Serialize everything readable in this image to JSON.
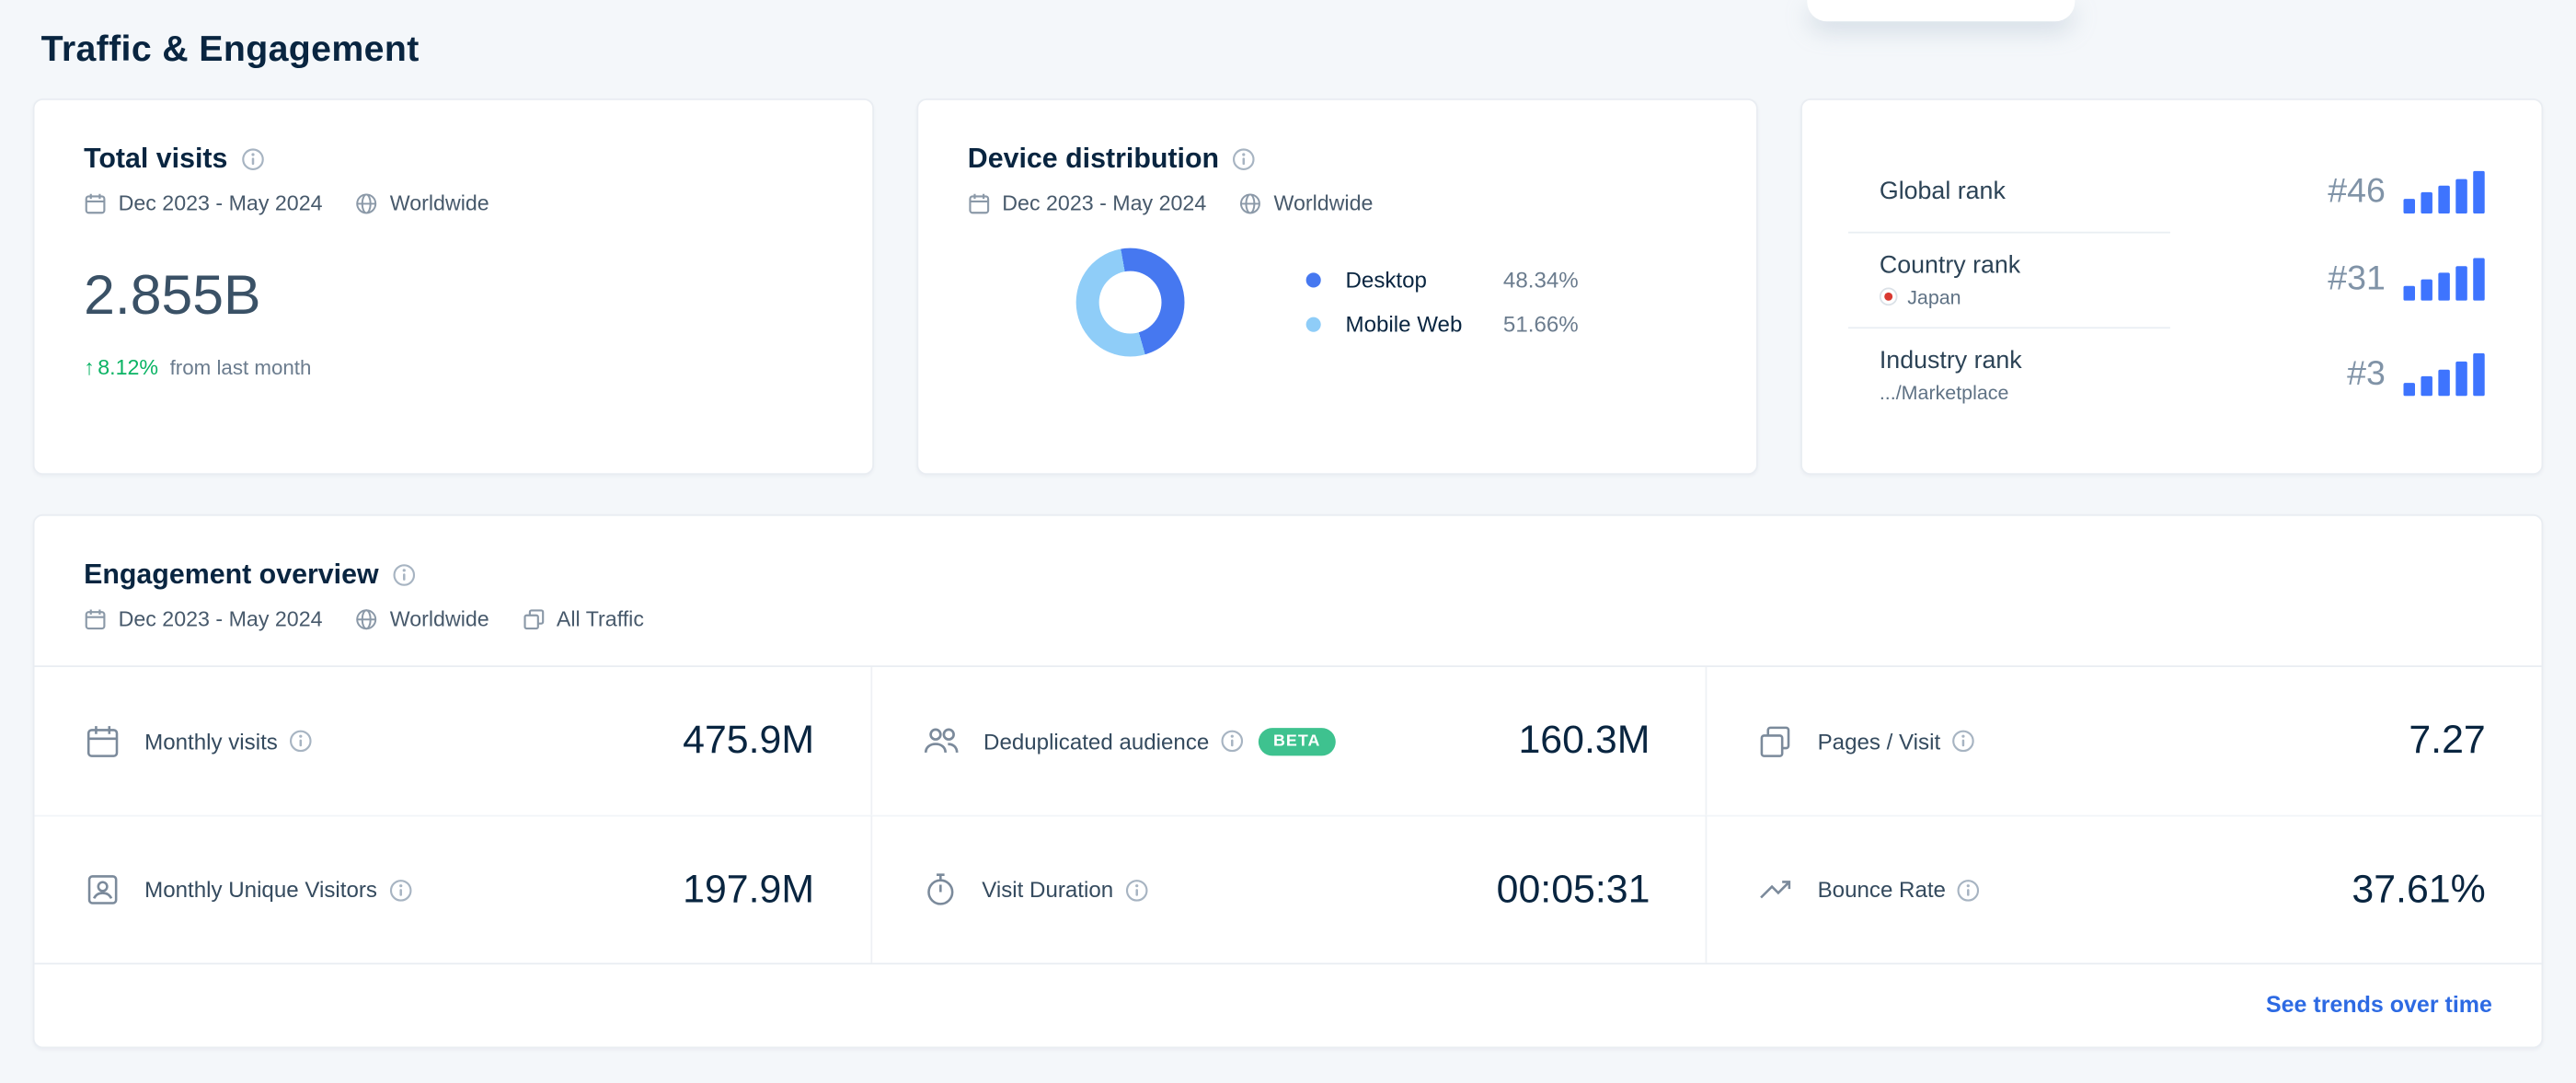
{
  "page": {
    "title": "Traffic & Engagement"
  },
  "total_visits": {
    "title": "Total visits",
    "date_range": "Dec 2023 - May 2024",
    "region": "Worldwide",
    "value": "2.855B",
    "change_arrow": "↑",
    "change": "8.12%",
    "change_label": "from last month"
  },
  "device_distribution": {
    "title": "Device distribution",
    "date_range": "Dec 2023 - May 2024",
    "region": "Worldwide",
    "legend": [
      {
        "label": "Desktop",
        "value": "48.34%",
        "color": "#4678F0"
      },
      {
        "label": "Mobile Web",
        "value": "51.66%",
        "color": "#8FCDF8"
      }
    ]
  },
  "ranks": {
    "global": {
      "label": "Global rank",
      "value": "#46"
    },
    "country": {
      "label": "Country rank",
      "country": "Japan",
      "value": "#31"
    },
    "industry": {
      "label": "Industry rank",
      "category": ".../Marketplace",
      "value": "#3"
    }
  },
  "engagement": {
    "title": "Engagement overview",
    "date_range": "Dec 2023 - May 2024",
    "region": "Worldwide",
    "traffic_type": "All Traffic",
    "metrics": [
      {
        "label": "Monthly visits",
        "value": "475.9M"
      },
      {
        "label": "Deduplicated audience",
        "value": "160.3M",
        "badge": "BETA"
      },
      {
        "label": "Pages / Visit",
        "value": "7.27"
      },
      {
        "label": "Monthly Unique Visitors",
        "value": "197.9M"
      },
      {
        "label": "Visit Duration",
        "value": "00:05:31"
      },
      {
        "label": "Bounce Rate",
        "value": "37.61%"
      }
    ],
    "link": "See trends over time"
  },
  "chart_data": {
    "type": "pie",
    "donut": true,
    "title": "Device distribution",
    "labels": [
      "Desktop",
      "Mobile Web"
    ],
    "values": [
      48.34,
      51.66
    ],
    "colors": [
      "#4678F0",
      "#8FCDF8"
    ],
    "legend_position": "right",
    "start_angle_deg": 350
  },
  "colors": {
    "accent_blue": "#2d6ae3",
    "rank_bars_blue": "#3e74fe",
    "positive_green": "#0ab364",
    "beta_badge": "#3ec28f",
    "background": "#f4f7fa",
    "text_dark": "#092540"
  }
}
